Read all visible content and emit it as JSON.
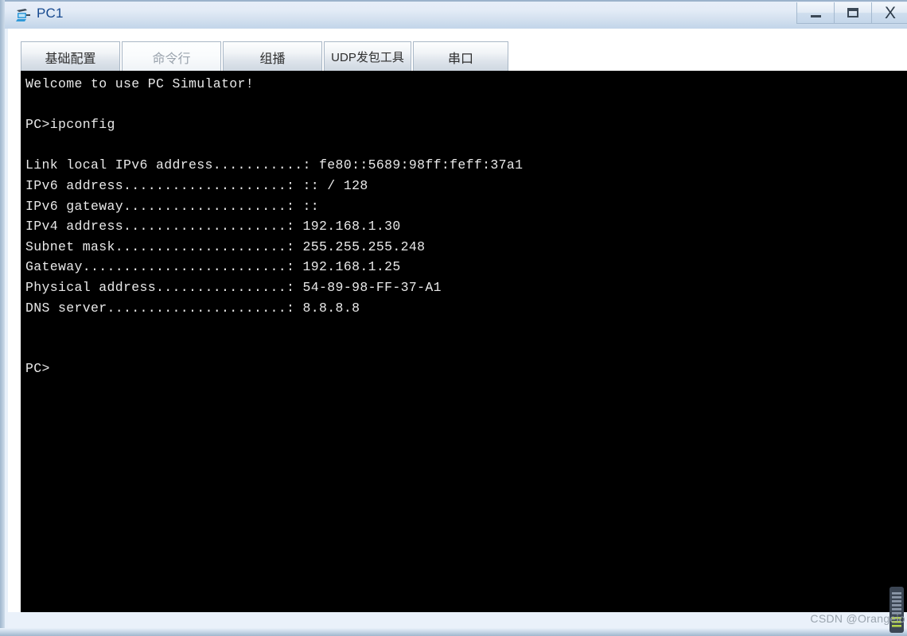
{
  "window": {
    "title": "PC1",
    "icon": "pc-device-icon",
    "controls": {
      "minimize_label": "–",
      "maximize_label": "□",
      "close_label": "X"
    },
    "colors": {
      "titlebar_start": "#e7eef8",
      "titlebar_end": "#c2d5e9",
      "title_text": "#16498f",
      "terminal_bg": "#000000",
      "terminal_fg": "#e9e9e9",
      "frame": "#9fb6cd"
    }
  },
  "tabs": [
    {
      "id": "basic-config",
      "label": "基础配置",
      "active": false
    },
    {
      "id": "command-line",
      "label": "命令行",
      "active": true
    },
    {
      "id": "multicast",
      "label": "组播",
      "active": false
    },
    {
      "id": "udp-tool",
      "label": "UDP发包工具",
      "active": false
    },
    {
      "id": "serial-port",
      "label": "串口",
      "active": false
    }
  ],
  "terminal": {
    "banner": "Welcome to use PC Simulator!",
    "prompt": "PC>",
    "command": "ipconfig",
    "final_prompt": "PC>",
    "results": [
      {
        "label": "Link local IPv6 address",
        "value": "fe80::5689:98ff:feff:37a1"
      },
      {
        "label": "IPv6 address",
        "value": ":: / 128"
      },
      {
        "label": "IPv6 gateway",
        "value": "::"
      },
      {
        "label": "IPv4 address",
        "value": "192.168.1.30"
      },
      {
        "label": "Subnet mask",
        "value": "255.255.255.248"
      },
      {
        "label": "Gateway",
        "value": "192.168.1.25"
      },
      {
        "label": "Physical address",
        "value": "54-89-98-FF-37-A1"
      },
      {
        "label": "DNS server",
        "value": "8.8.8.8"
      }
    ],
    "screen_text": "Welcome to use PC Simulator!\n\nPC>ipconfig\n\nLink local IPv6 address...........: fe80::5689:98ff:feff:37a1\nIPv6 address....................: :: / 128\nIPv6 gateway....................: ::\nIPv4 address....................: 192.168.1.30\nSubnet mask.....................: 255.255.255.248\nGateway.........................: 192.168.1.25\nPhysical address................: 54-89-98-FF-37-A1\nDNS server......................: 8.8.8.8\n\n\nPC>"
  },
  "watermark": {
    "text": "CSDN @Orangeio"
  }
}
